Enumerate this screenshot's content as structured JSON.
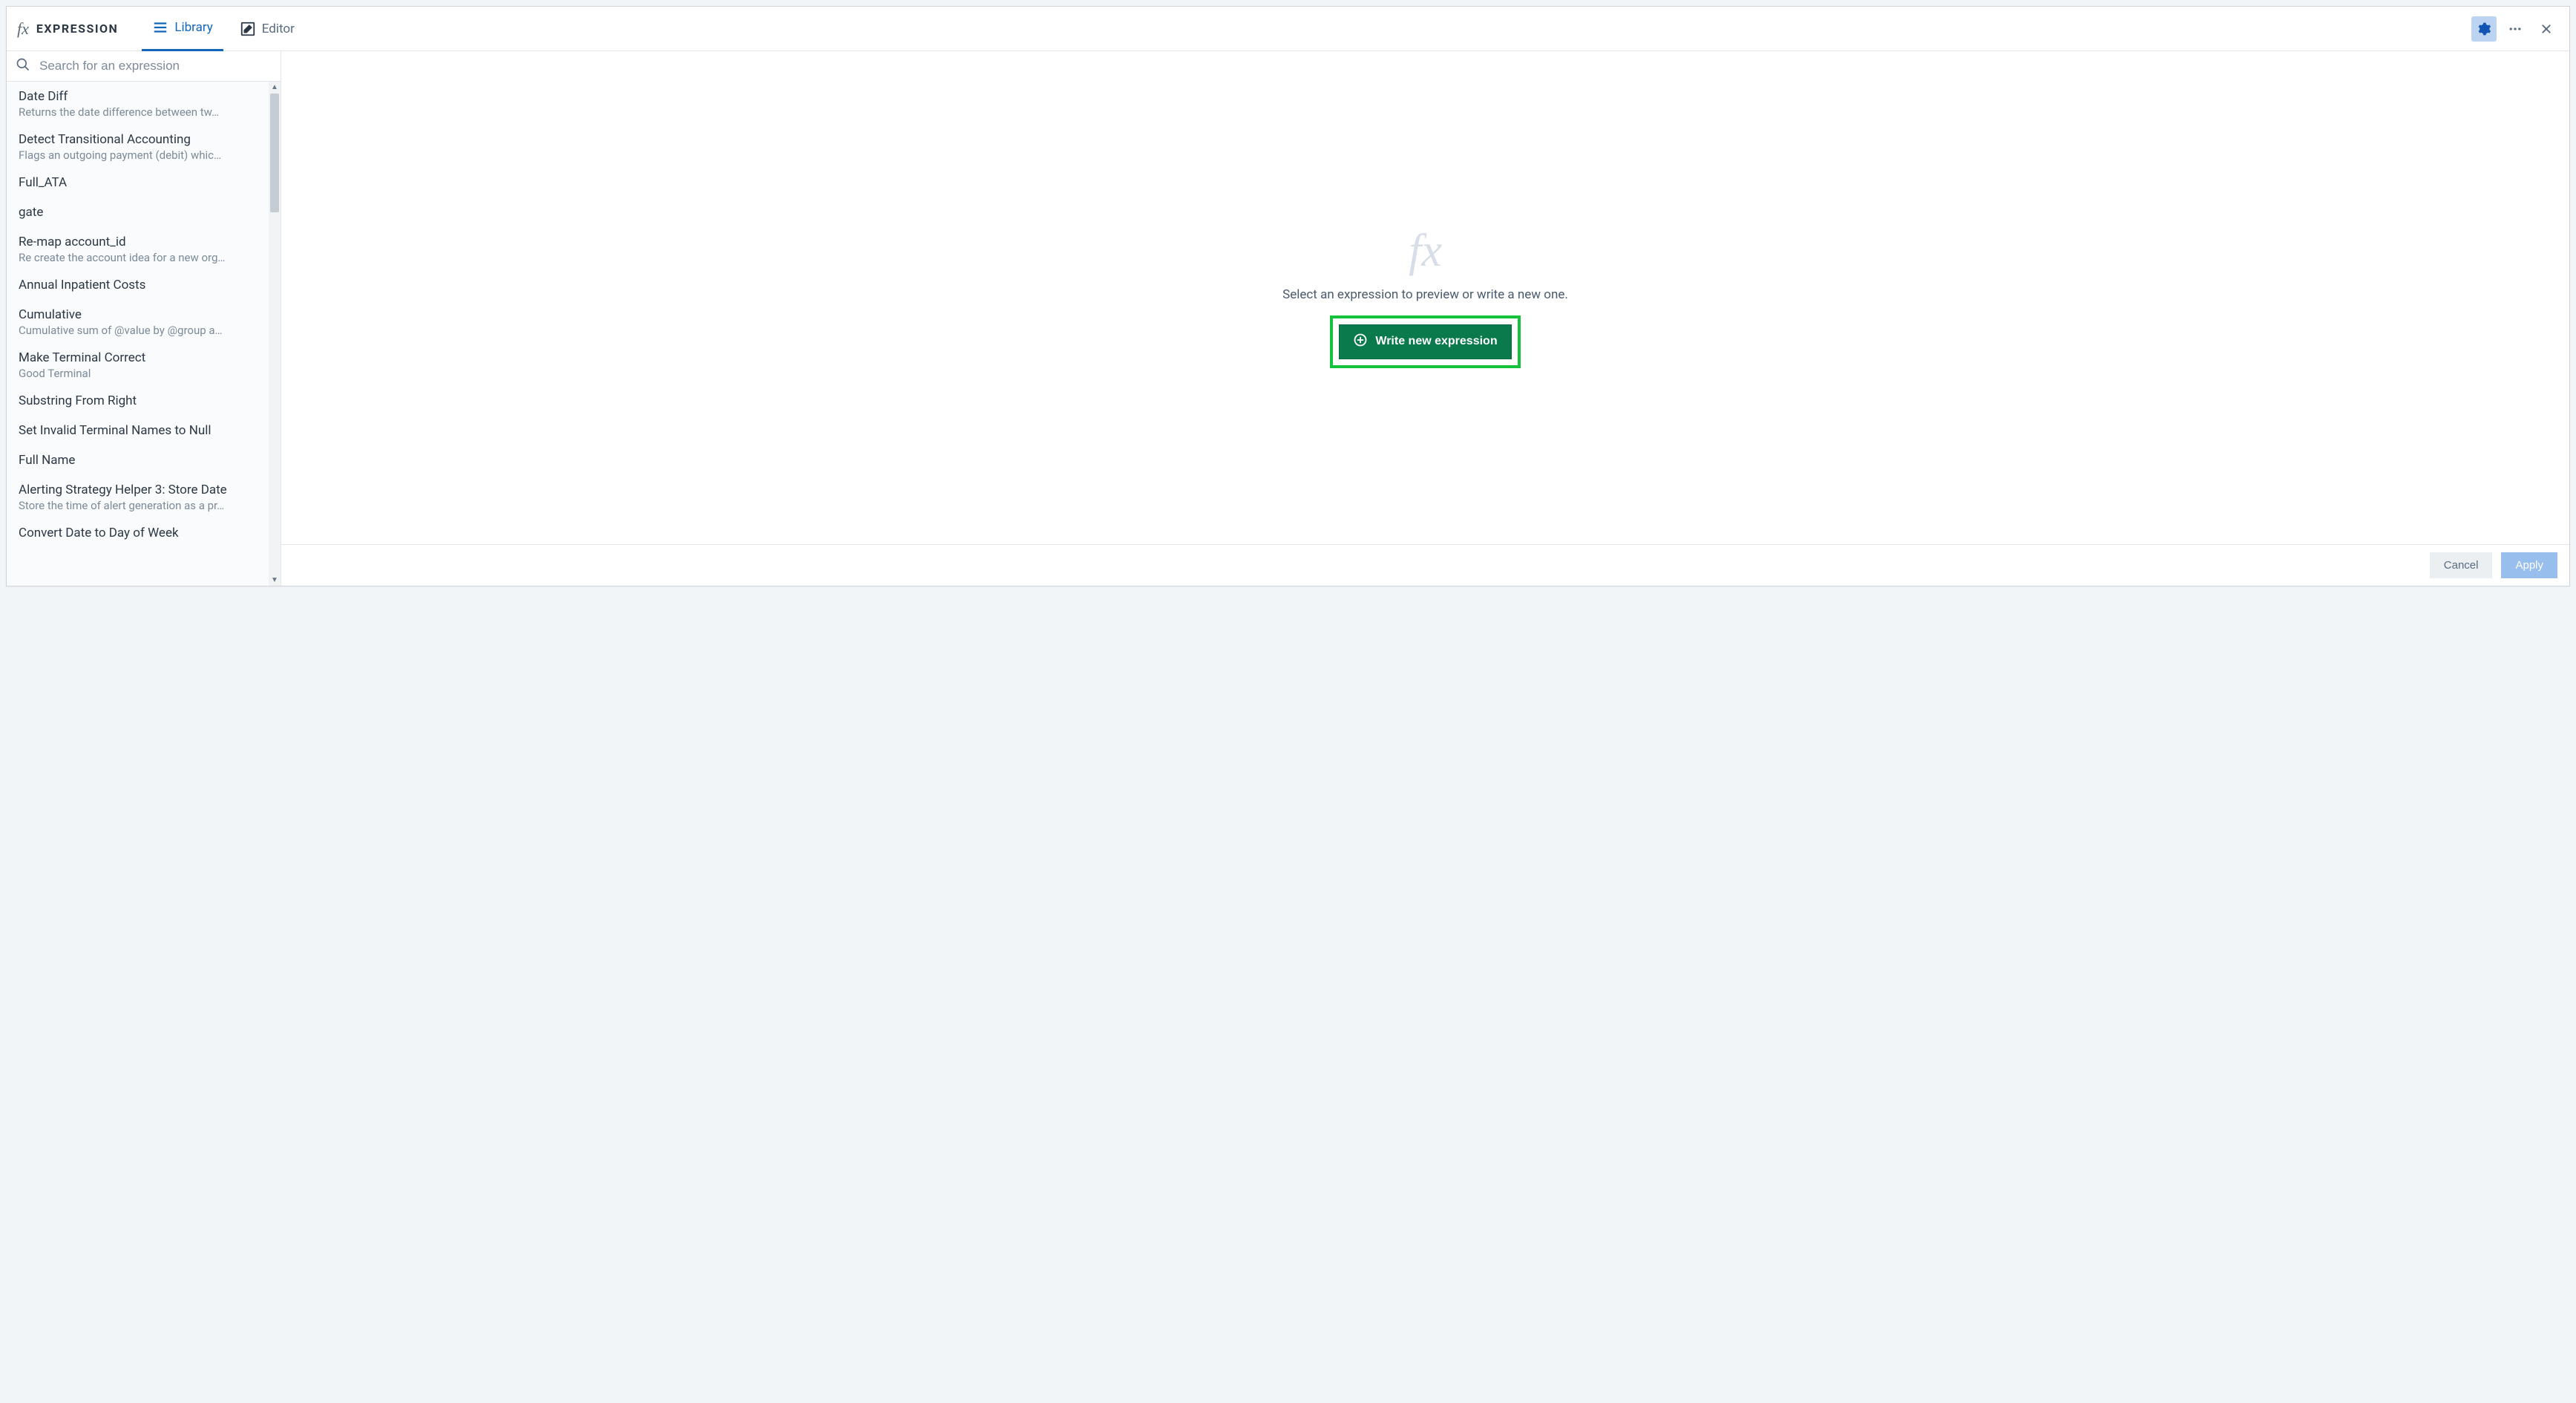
{
  "header": {
    "fx_label": "fx",
    "title": "EXPRESSION",
    "tabs": [
      {
        "id": "library",
        "label": "Library",
        "icon": "hamburger-icon",
        "active": true
      },
      {
        "id": "editor",
        "label": "Editor",
        "icon": "edit-icon",
        "active": false
      }
    ]
  },
  "search": {
    "placeholder": "Search for an expression"
  },
  "expressions": [
    {
      "title": "Date Diff",
      "subtitle": "Returns the date difference between tw…"
    },
    {
      "title": "Detect Transitional Accounting",
      "subtitle": "Flags an outgoing payment (debit) whic…"
    },
    {
      "title": "Full_ATA",
      "subtitle": ""
    },
    {
      "title": "gate",
      "subtitle": ""
    },
    {
      "title": "Re-map account_id",
      "subtitle": "Re create the account idea for a new org…"
    },
    {
      "title": "Annual Inpatient Costs",
      "subtitle": ""
    },
    {
      "title": "Cumulative",
      "subtitle": "Cumulative sum of @value by @group a…"
    },
    {
      "title": "Make Terminal Correct",
      "subtitle": "Good Terminal"
    },
    {
      "title": "Substring From Right",
      "subtitle": ""
    },
    {
      "title": "Set Invalid Terminal Names to Null",
      "subtitle": ""
    },
    {
      "title": "Full Name",
      "subtitle": ""
    },
    {
      "title": "Alerting Strategy Helper 3: Store Date",
      "subtitle": "Store the time of alert generation as a pr…"
    },
    {
      "title": "Convert Date to Day of Week",
      "subtitle": ""
    }
  ],
  "empty_state": {
    "fx_glyph": "fx",
    "message": "Select an expression to preview or write a new one.",
    "cta_label": "Write new expression"
  },
  "footer": {
    "cancel": "Cancel",
    "apply": "Apply"
  }
}
